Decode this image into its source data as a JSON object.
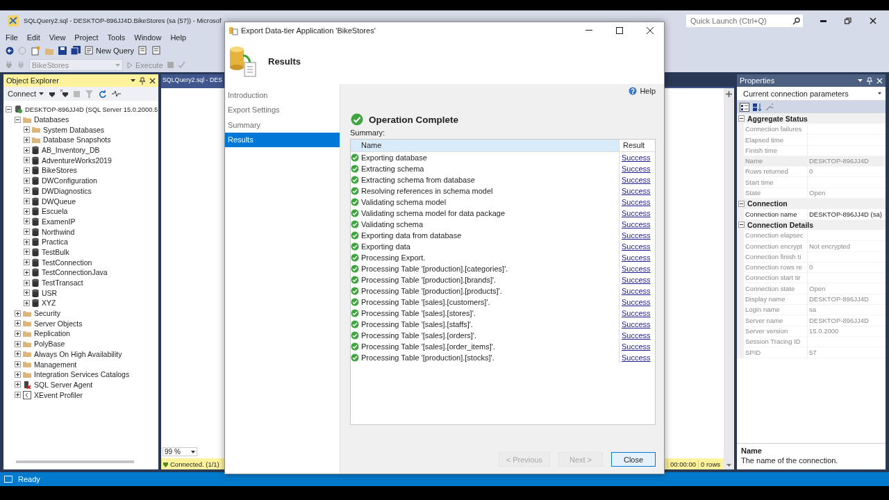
{
  "app": {
    "title": "SQLQuery2.sql - DESKTOP-896JJ4D.BikeStores (sa (57)) - Microsof",
    "quick_launch": {
      "placeholder": "Quick Launch (Ctrl+Q)"
    }
  },
  "menu": [
    "File",
    "Edit",
    "View",
    "Project",
    "Tools",
    "Window",
    "Help"
  ],
  "toolbar": {
    "new_query": "New Query",
    "database": "BikeStores",
    "execute": "Execute"
  },
  "object_explorer": {
    "title": "Object Explorer",
    "connect": "Connect",
    "tree": [
      {
        "label": "DESKTOP-896JJ4D (SQL Server 15.0.2000.5",
        "kind": "server",
        "expanded": true,
        "children": [
          {
            "label": "Databases",
            "kind": "folder",
            "expanded": true,
            "children": [
              {
                "label": "System Databases",
                "kind": "folder",
                "expanded": false
              },
              {
                "label": "Database Snapshots",
                "kind": "folder",
                "expanded": false
              },
              {
                "label": "AB_Inventory_DB",
                "kind": "database",
                "expanded": false
              },
              {
                "label": "AdventureWorks2019",
                "kind": "database",
                "expanded": false
              },
              {
                "label": "BikeStores",
                "kind": "database",
                "expanded": false
              },
              {
                "label": "DWConfiguration",
                "kind": "database",
                "expanded": false
              },
              {
                "label": "DWDiagnostics",
                "kind": "database",
                "expanded": false
              },
              {
                "label": "DWQueue",
                "kind": "database",
                "expanded": false
              },
              {
                "label": "Escuela",
                "kind": "database",
                "expanded": false
              },
              {
                "label": "ExamenIP",
                "kind": "database",
                "expanded": false
              },
              {
                "label": "Northwind",
                "kind": "database",
                "expanded": false
              },
              {
                "label": "Practica",
                "kind": "database",
                "expanded": false
              },
              {
                "label": "TestBulk",
                "kind": "database",
                "expanded": false
              },
              {
                "label": "TestConnection",
                "kind": "database",
                "expanded": false
              },
              {
                "label": "TestConnectionJava",
                "kind": "database",
                "expanded": false
              },
              {
                "label": "TestTransact",
                "kind": "database",
                "expanded": false
              },
              {
                "label": "USR",
                "kind": "database",
                "expanded": false
              },
              {
                "label": "XYZ",
                "kind": "database",
                "expanded": false
              }
            ]
          },
          {
            "label": "Security",
            "kind": "folder",
            "expanded": false
          },
          {
            "label": "Server Objects",
            "kind": "folder",
            "expanded": false
          },
          {
            "label": "Replication",
            "kind": "folder",
            "expanded": false
          },
          {
            "label": "PolyBase",
            "kind": "folder",
            "expanded": false
          },
          {
            "label": "Always On High Availability",
            "kind": "folder",
            "expanded": false
          },
          {
            "label": "Management",
            "kind": "folder",
            "expanded": false
          },
          {
            "label": "Integration Services Catalogs",
            "kind": "folder",
            "expanded": false
          },
          {
            "label": "SQL Server Agent",
            "kind": "agent",
            "expanded": false
          },
          {
            "label": "XEvent Profiler",
            "kind": "profiler",
            "expanded": false
          }
        ]
      }
    ]
  },
  "editor": {
    "tab": "SQLQuery2.sql - DES",
    "zoom": "99 %",
    "status": "Connected. (1/1)",
    "time": "00:00:00",
    "rows": "0 rows"
  },
  "properties": {
    "title": "Properties",
    "object": "Current connection parameters",
    "sections": [
      {
        "title": "Aggregate Status",
        "expanded": true,
        "rows": [
          {
            "name": "Connection failures",
            "value": "",
            "disabled": true,
            "selected": false
          },
          {
            "name": "Elapsed time",
            "value": "",
            "disabled": true,
            "selected": false
          },
          {
            "name": "Finish time",
            "value": "",
            "disabled": true,
            "selected": false
          },
          {
            "name": "Name",
            "value": "DESKTOP-896JJ4D",
            "disabled": true,
            "selected": true
          },
          {
            "name": "Rows returned",
            "value": "0",
            "disabled": true,
            "selected": false
          },
          {
            "name": "Start time",
            "value": "",
            "disabled": true,
            "selected": false
          },
          {
            "name": "State",
            "value": "Open",
            "disabled": true,
            "selected": false
          }
        ]
      },
      {
        "title": "Connection",
        "expanded": true,
        "rows": [
          {
            "name": "Connection name",
            "value": "DESKTOP-896JJ4D (sa)",
            "disabled": false,
            "selected": false
          }
        ]
      },
      {
        "title": "Connection Details",
        "expanded": true,
        "rows": [
          {
            "name": "Connection elapsec",
            "value": "",
            "disabled": true,
            "selected": false
          },
          {
            "name": "Connection encrypt",
            "value": "Not encrypted",
            "disabled": true,
            "selected": false
          },
          {
            "name": "Connection finish ti",
            "value": "",
            "disabled": true,
            "selected": false
          },
          {
            "name": "Connection rows re",
            "value": "0",
            "disabled": true,
            "selected": false
          },
          {
            "name": "Connection start tir",
            "value": "",
            "disabled": true,
            "selected": false
          },
          {
            "name": "Connection state",
            "value": "Open",
            "disabled": true,
            "selected": false
          },
          {
            "name": "Display name",
            "value": "DESKTOP-896JJ4D",
            "disabled": true,
            "selected": false
          },
          {
            "name": "Login name",
            "value": "sa",
            "disabled": true,
            "selected": false
          },
          {
            "name": "Server name",
            "value": "DESKTOP-896JJ4D",
            "disabled": true,
            "selected": false
          },
          {
            "name": "Server version",
            "value": "15.0.2000",
            "disabled": true,
            "selected": false
          },
          {
            "name": "Session Tracing ID",
            "value": "",
            "disabled": true,
            "selected": false
          },
          {
            "name": "SPID",
            "value": "57",
            "disabled": true,
            "selected": false
          }
        ]
      }
    ],
    "description": {
      "title": "Name",
      "text": "The name of the connection."
    }
  },
  "dialog": {
    "title": "Export Data-tier Application 'BikeStores'",
    "heading": "Results",
    "steps": [
      {
        "label": "Introduction",
        "selected": false
      },
      {
        "label": "Export Settings",
        "selected": false
      },
      {
        "label": "Summary",
        "selected": false
      },
      {
        "label": "Results",
        "selected": true
      }
    ],
    "help": "Help",
    "status": "Operation Complete",
    "summary_label": "Summary:",
    "columns": [
      "Name",
      "Result"
    ],
    "rows": [
      {
        "name": "Exporting database",
        "result": "Success"
      },
      {
        "name": "Extracting schema",
        "result": "Success"
      },
      {
        "name": "Extracting schema from database",
        "result": "Success"
      },
      {
        "name": "Resolving references in schema model",
        "result": "Success"
      },
      {
        "name": "Validating schema model",
        "result": "Success"
      },
      {
        "name": "Validating schema model for data package",
        "result": "Success"
      },
      {
        "name": "Validating schema",
        "result": "Success"
      },
      {
        "name": "Exporting data from database",
        "result": "Success"
      },
      {
        "name": "Exporting data",
        "result": "Success"
      },
      {
        "name": "Processing Export.",
        "result": "Success"
      },
      {
        "name": "Processing Table '[production].[categories]'.",
        "result": "Success"
      },
      {
        "name": "Processing Table '[production].[brands]'.",
        "result": "Success"
      },
      {
        "name": "Processing Table '[production].[products]'.",
        "result": "Success"
      },
      {
        "name": "Processing Table '[sales].[customers]'.",
        "result": "Success"
      },
      {
        "name": "Processing Table '[sales].[stores]'.",
        "result": "Success"
      },
      {
        "name": "Processing Table '[sales].[staffs]'.",
        "result": "Success"
      },
      {
        "name": "Processing Table '[sales].[orders]'.",
        "result": "Success"
      },
      {
        "name": "Processing Table '[sales].[order_items]'.",
        "result": "Success"
      },
      {
        "name": "Processing Table '[production].[stocks]'.",
        "result": "Success"
      }
    ],
    "buttons": [
      {
        "label": "< Previous",
        "disabled": true
      },
      {
        "label": "Next >",
        "disabled": true
      },
      {
        "label": "Close",
        "disabled": false
      }
    ]
  },
  "status_bar": "Ready"
}
